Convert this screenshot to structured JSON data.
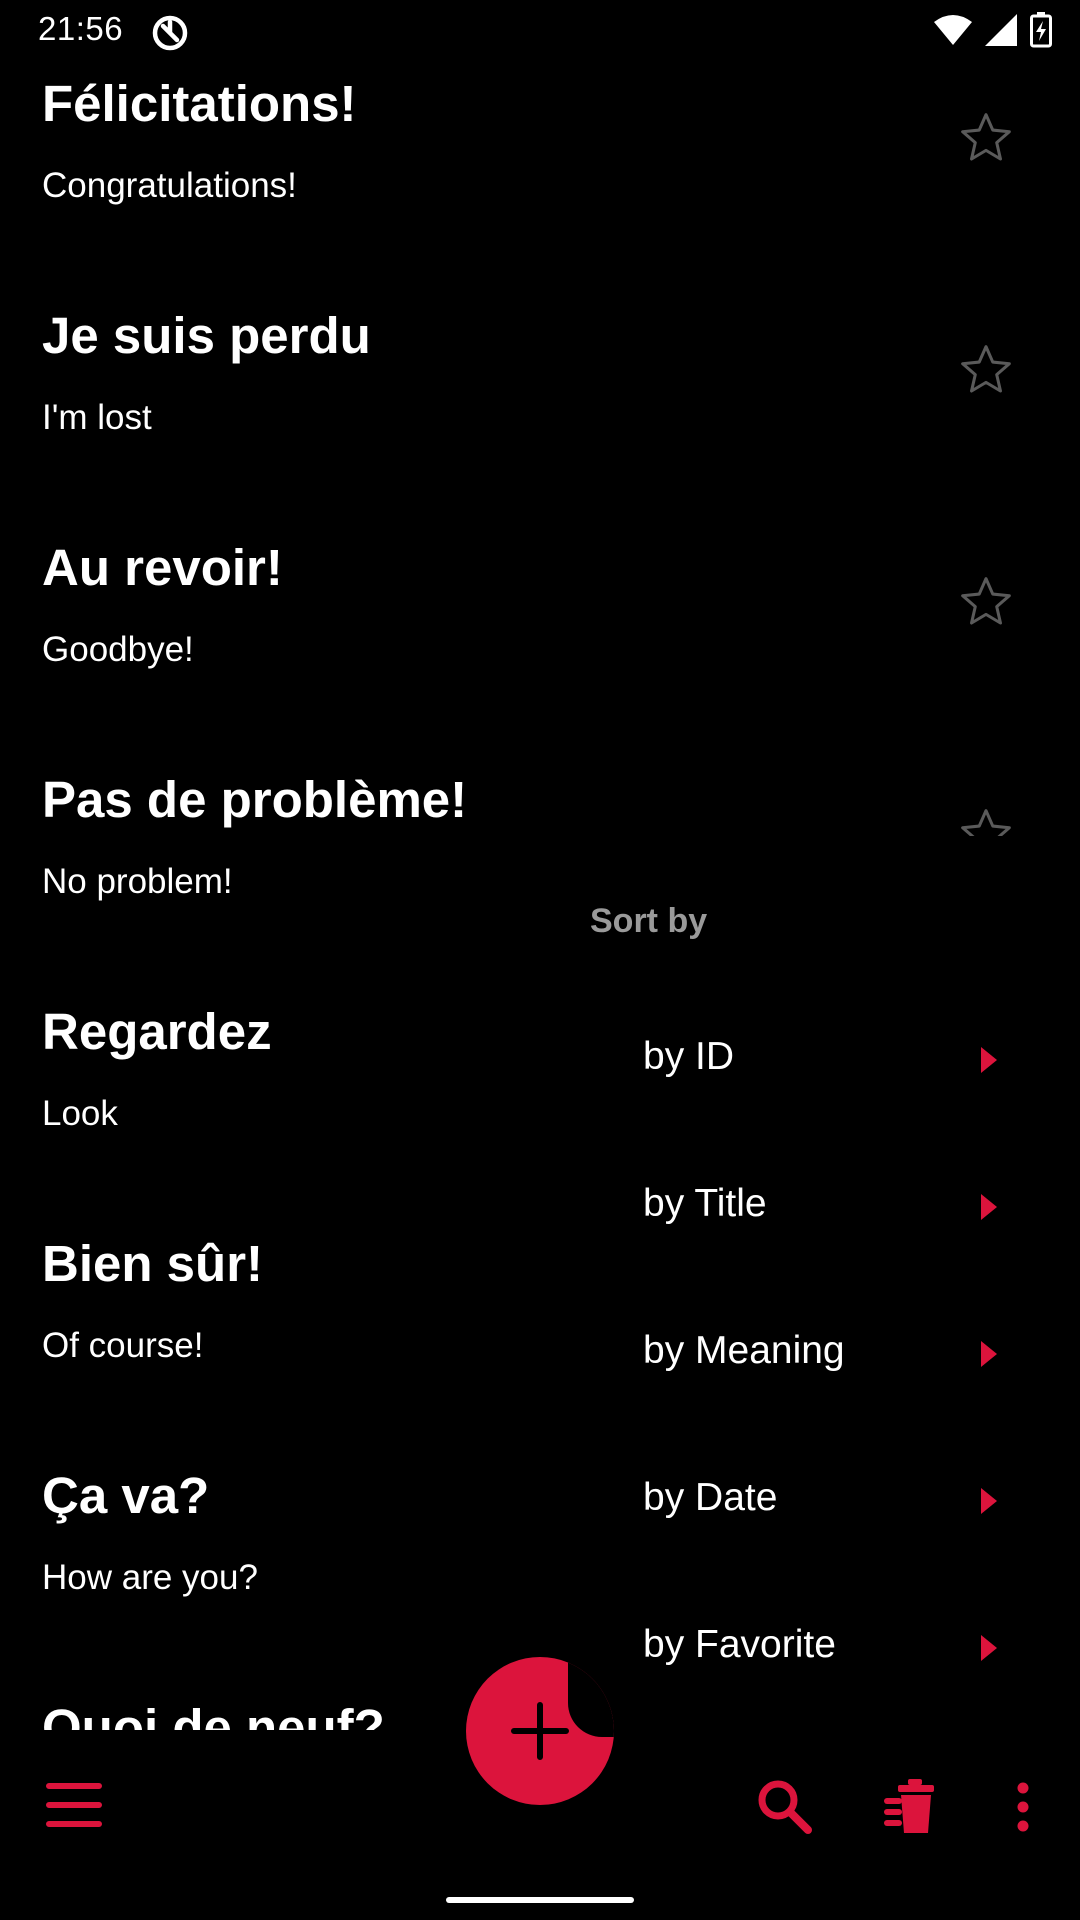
{
  "status_bar": {
    "time": "21:56"
  },
  "phrases": [
    {
      "title": "Félicitations!",
      "meaning": "Congratulations!"
    },
    {
      "title": "Je suis perdu",
      "meaning": "I'm lost"
    },
    {
      "title": "Au revoir!",
      "meaning": "Goodbye!"
    },
    {
      "title": "Pas de problème!",
      "meaning": "No problem!"
    },
    {
      "title": "Regardez",
      "meaning": "Look"
    },
    {
      "title": "Bien sûr!",
      "meaning": "Of course!"
    },
    {
      "title": "Ça va?",
      "meaning": "How are you?"
    },
    {
      "title": "Quoi de neuf?",
      "meaning": ""
    }
  ],
  "sort_menu": {
    "header": "Sort by",
    "options": [
      {
        "label": "by ID"
      },
      {
        "label": "by Title"
      },
      {
        "label": "by Meaning"
      },
      {
        "label": "by Date"
      },
      {
        "label": "by Favorite"
      }
    ]
  },
  "icons": {
    "star": "star-outline-icon",
    "menu": "hamburger-menu-icon",
    "search": "search-icon",
    "delete": "delete-icon",
    "more": "more-vertical-icon",
    "add": "plus-icon"
  },
  "colors": {
    "accent": "#dc143c",
    "background": "#000000",
    "text": "#ffffff",
    "muted": "#9a9a9a",
    "star_outline": "#5a5a5a"
  }
}
